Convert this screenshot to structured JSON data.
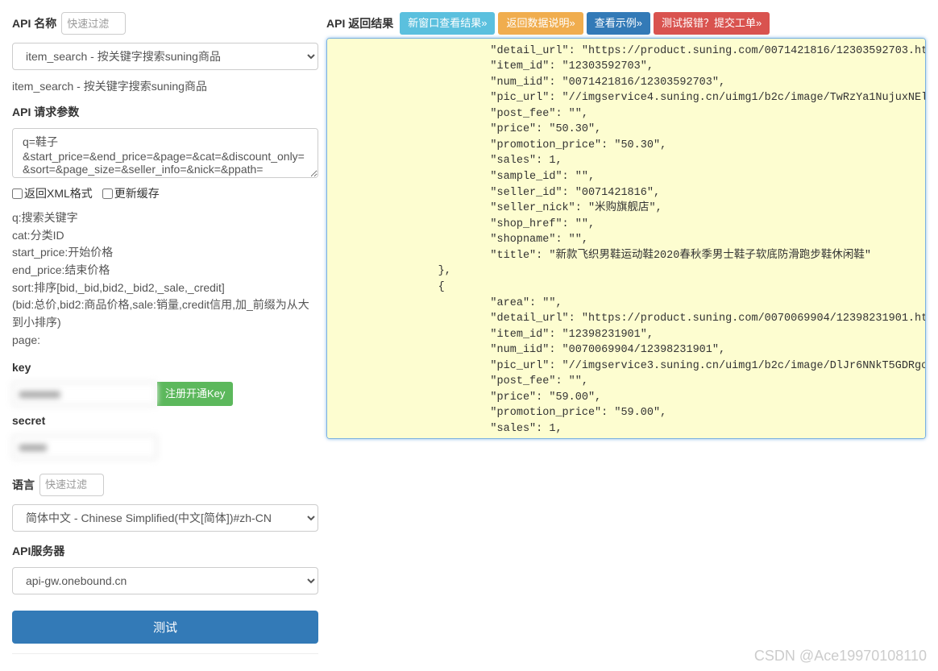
{
  "left": {
    "api_name_label": "API 名称",
    "api_name_placeholder": "快速过滤",
    "api_select_value": "item_search - 按关键字搜索suning商品",
    "api_subtext": "item_search - 按关键字搜索suning商品",
    "req_params_label": "API 请求参数",
    "req_params_value": "q=鞋子&start_price=&end_price=&page=&cat=&discount_only=&sort=&page_size=&seller_info=&nick=&ppath=",
    "chk_xml": "返回XML格式",
    "chk_cache": "更新缓存",
    "param_desc": [
      "q:搜索关键字",
      "cat:分类ID",
      "start_price:开始价格",
      "end_price:结束价格",
      "sort:排序[bid,_bid,bid2,_bid2,_sale,_credit]",
      "  (bid:总价,bid2:商品价格,sale:销量,credit信用,加_前缀为从大到小排序)",
      "page:"
    ],
    "key_label": "key",
    "key_value": "■■■■■■",
    "key_btn": "注册开通Key",
    "secret_label": "secret",
    "secret_value": "■■■■",
    "lang_label": "语言",
    "lang_placeholder": "快速过滤",
    "lang_select": "简体中文 - Chinese Simplified(中文[简体])#zh-CN",
    "server_label": "API服务器",
    "server_select": "api-gw.onebound.cn",
    "test_btn": "测试"
  },
  "right": {
    "title": "API 返回结果",
    "btn_newwin": "新窗口查看结果»",
    "btn_datadesc": "返回数据说明»",
    "btn_example": "查看示例»",
    "btn_bug": "测试报错？提交工单»",
    "json_text": "                        \"detail_url\": \"https://product.suning.com/0071421816/12303592703.html\",\n                        \"item_id\": \"12303592703\",\n                        \"num_iid\": \"0071421816/12303592703\",\n                        \"pic_url\": \"//imgservice4.suning.cn/uimg1/b2c/image/TwRzYa1NujuxNEloucAfRA.jpg\",\n                        \"post_fee\": \"\",\n                        \"price\": \"50.30\",\n                        \"promotion_price\": \"50.30\",\n                        \"sales\": 1,\n                        \"sample_id\": \"\",\n                        \"seller_id\": \"0071421816\",\n                        \"seller_nick\": \"米购旗舰店\",\n                        \"shop_href\": \"\",\n                        \"shopname\": \"\",\n                        \"title\": \"新款飞织男鞋运动鞋2020春秋季男士鞋子软底防滑跑步鞋休闲鞋\"\n                },\n                {\n                        \"area\": \"\",\n                        \"detail_url\": \"https://product.suning.com/0070069904/12398231901.html\",\n                        \"item_id\": \"12398231901\",\n                        \"num_iid\": \"0070069904/12398231901\",\n                        \"pic_url\": \"//imgservice3.suning.cn/uimg1/b2c/image/DlJr6NNkT5GDRgoKu-rD6g.jpg\",\n                        \"post_fee\": \"\",\n                        \"price\": \"59.00\",\n                        \"promotion_price\": \"59.00\",\n                        \"sales\": 1,"
  },
  "watermark": "CSDN @Ace19970108110"
}
